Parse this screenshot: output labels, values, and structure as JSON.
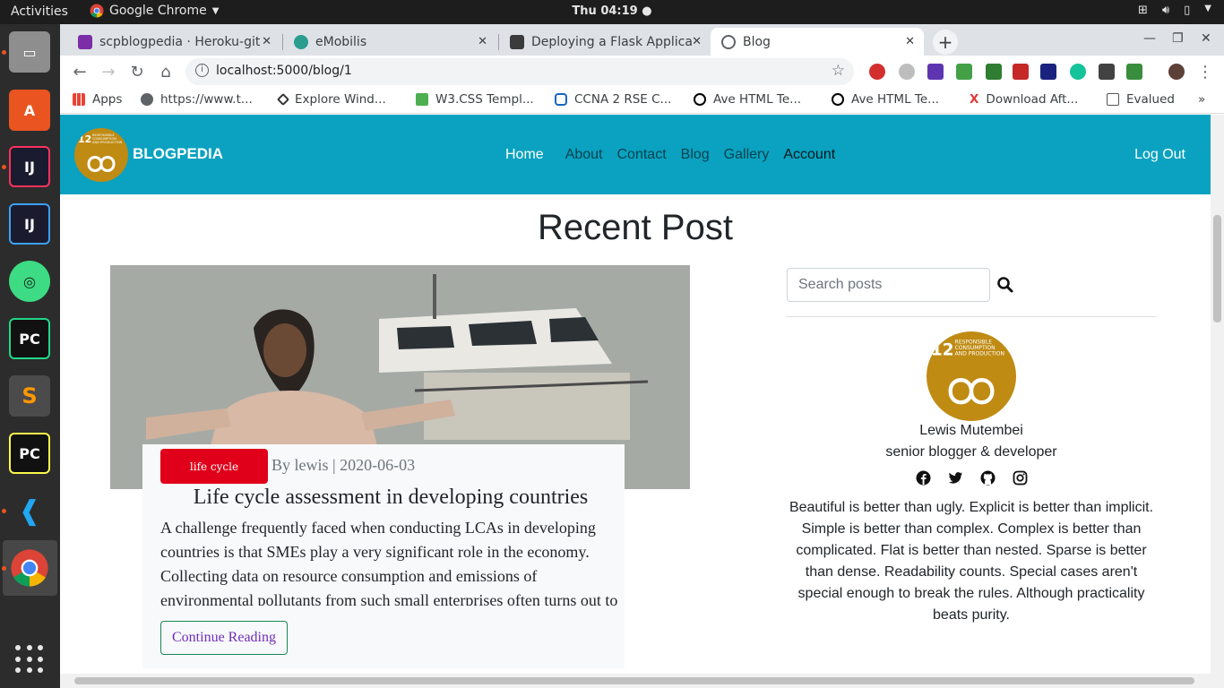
{
  "system": {
    "activities": "Activities",
    "app_name": "Google Chrome",
    "clock": "Thu 04:19"
  },
  "browser": {
    "tabs": [
      {
        "title": "scpblogpedia · Heroku-git",
        "favicon_color": "#7b2ea5"
      },
      {
        "title": "eMobilis",
        "favicon_color": "#2a9d8f"
      },
      {
        "title": "Deploying a Flask Applicat",
        "favicon_color": "#3b3b3b"
      },
      {
        "title": "Blog",
        "favicon_color": "#5f6368"
      }
    ],
    "url": "localhost:5000/blog/1",
    "bookmarks": [
      {
        "label": "Apps"
      },
      {
        "label": "https://www.t..."
      },
      {
        "label": "Explore Wind..."
      },
      {
        "label": "W3.CSS Templ..."
      },
      {
        "label": "CCNA 2 RSE C..."
      },
      {
        "label": "Ave HTML Te..."
      },
      {
        "label": "Ave HTML Te..."
      },
      {
        "label": "Download Aft..."
      },
      {
        "label": "Evalued"
      }
    ],
    "bookmarks_overflow": "»"
  },
  "site": {
    "brand": "BLOGPEDIA",
    "logo_text": [
      "12",
      "RESPONSIBLE",
      "CONSUMPTION",
      "AND PRODUCTION"
    ],
    "nav": [
      "Home",
      "About",
      "Contact",
      "Blog",
      "Gallery",
      "Account"
    ],
    "logout": "Log Out",
    "heading": "Recent Post",
    "accent_color": "#0aa2c0"
  },
  "post": {
    "category": "life cycle",
    "byline": "By lewis | 2020-06-03",
    "title": "Life cycle assessment in developing countries",
    "excerpt": "A challenge frequently faced when conducting LCAs in developing countries is that SMEs play a very significant role in the economy. Collecting data on resource consumption and emissions of environmental pollutants from such small enterprises often turns out to",
    "cta": "Continue Reading"
  },
  "sidebar": {
    "search_placeholder": "Search posts",
    "author_name": "Lewis Mutembei",
    "author_role": "senior blogger & developer",
    "socials": [
      "facebook-icon",
      "twitter-icon",
      "github-icon",
      "instagram-icon"
    ],
    "bio": "Beautiful is better than ugly. Explicit is better than implicit. Simple is better than complex. Complex is better than complicated. Flat is better than nested. Sparse is better than dense. Readability counts. Special cases aren't special enough to break the rules. Although practicality beats purity."
  }
}
